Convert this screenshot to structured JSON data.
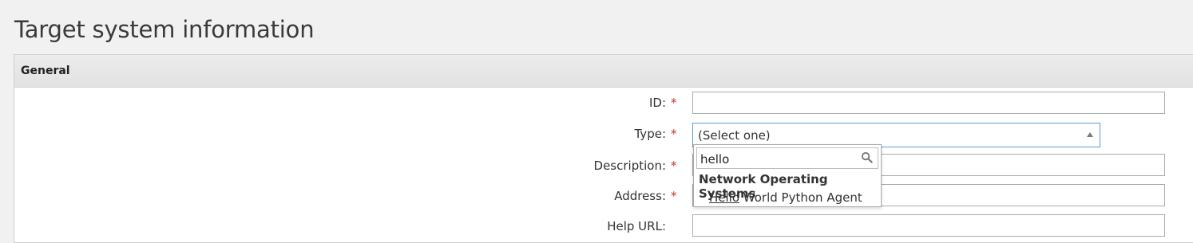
{
  "page": {
    "title": "Target system information"
  },
  "panel": {
    "header": "General"
  },
  "form": {
    "id_label": "ID:",
    "type_label": "Type:",
    "description_label": "Description:",
    "address_label": "Address:",
    "help_url_label": "Help URL:",
    "required_mark": "*",
    "id_value": "",
    "description_value": "",
    "address_value": "",
    "help_url_value": "",
    "type_selected": "(Select one)"
  },
  "type_dropdown": {
    "search_value": "hello",
    "group_label": "Network Operating Systems",
    "option_match": "Hello",
    "option_rest": " World Python Agent"
  },
  "colors": {
    "required": "#c0392b",
    "focus_border": "#5b9bd5"
  }
}
